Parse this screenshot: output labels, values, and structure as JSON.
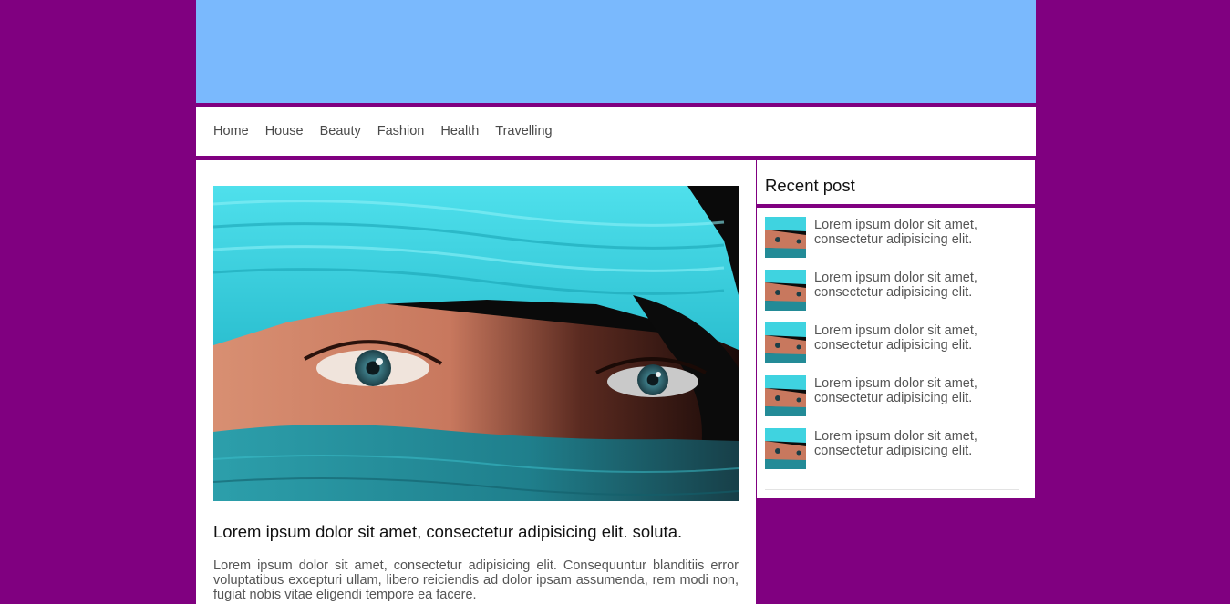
{
  "nav": {
    "items": [
      {
        "label": "Home"
      },
      {
        "label": "House"
      },
      {
        "label": "Beauty"
      },
      {
        "label": "Fashion"
      },
      {
        "label": "Health"
      },
      {
        "label": "Travelling"
      }
    ]
  },
  "post": {
    "title": "Lorem ipsum dolor sit amet, consectetur adipisicing elit. soluta.",
    "excerpt": "Lorem ipsum dolor sit amet, consectetur adipisicing elit. Consequuntur blanditiis error voluptatibus excepturi ullam, libero reiciendis ad dolor ipsam assumenda, rem modi non, fugiat nobis vitae eligendi tempore ea facere."
  },
  "sidebar": {
    "title": "Recent post",
    "items": [
      {
        "text": "Lorem ipsum dolor sit amet, consectetur adipisicing elit."
      },
      {
        "text": "Lorem ipsum dolor sit amet, consectetur adipisicing elit."
      },
      {
        "text": "Lorem ipsum dolor sit amet, consectetur adipisicing elit."
      },
      {
        "text": "Lorem ipsum dolor sit amet, consectetur adipisicing elit."
      },
      {
        "text": "Lorem ipsum dolor sit amet, consectetur adipisicing elit."
      }
    ]
  },
  "colors": {
    "background": "#800080",
    "header_banner": "#7ab9fd",
    "panel": "#ffffff",
    "accent_rule": "#800080"
  }
}
